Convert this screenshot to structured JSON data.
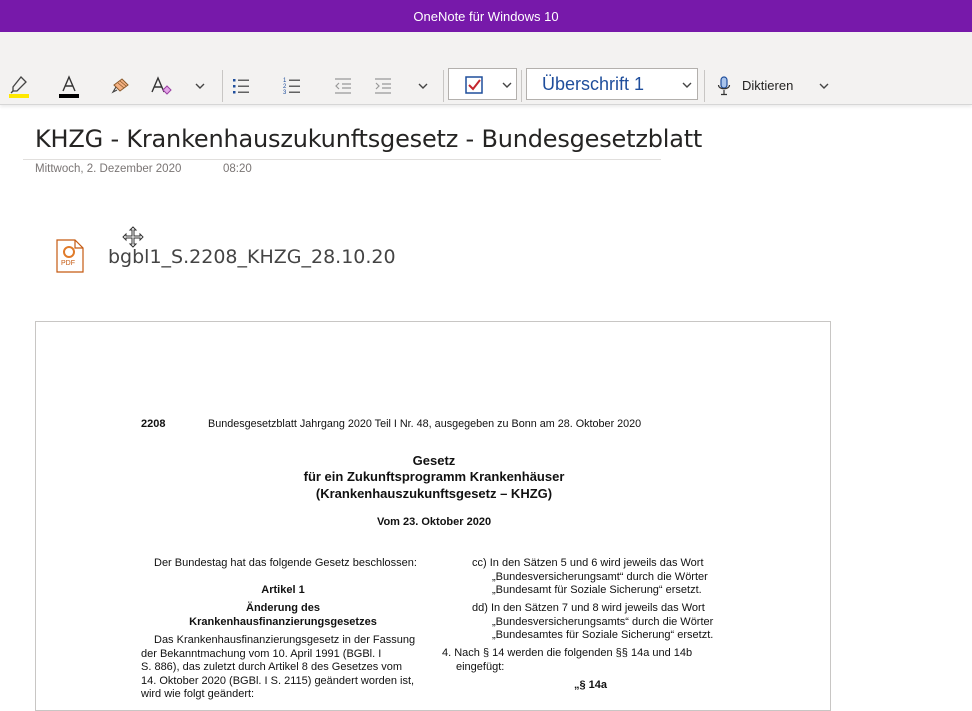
{
  "app": {
    "title": "OneNote für Windows 10"
  },
  "ribbon": {
    "highlight_color": "#ffe800",
    "font_color": "#000000",
    "style_value": "Überschrift 1",
    "dictate_label": "Diktieren",
    "icons": [
      "highlighter-icon",
      "font-color-icon",
      "format-painter-icon",
      "clear-formatting-icon",
      "bullets-icon",
      "numbering-icon",
      "outdent-icon",
      "indent-icon",
      "todo-checkbox-icon",
      "microphone-icon"
    ]
  },
  "page": {
    "title": "KHZG - Krankenhauszukunftsgesetz - Bundesgesetzblatt",
    "date": "Mittwoch, 2. Dezember 2020",
    "time": "08:20",
    "attachment": {
      "filename": "bgbl1_S.2208_KHZG_28.10.20",
      "icon": "pdf-file-icon",
      "icon_label": "PDF"
    }
  },
  "pdf": {
    "page_number": "2208",
    "header": "Bundesgesetzblatt Jahrgang 2020 Teil I Nr. 48, ausgegeben zu Bonn am 28. Oktober 2020",
    "title_line1": "Gesetz",
    "title_line2": "für ein Zukunftsprogramm Krankenhäuser",
    "title_line3": "(Krankenhauszukunftsgesetz – KHZG)",
    "date_line": "Vom 23. Oktober 2020",
    "left": {
      "intro": "Der Bundestag hat das folgende Gesetz beschlossen:",
      "article": "Artikel 1",
      "article_title1": "Änderung des",
      "article_title2": "Krankenhausfinanzierungsgesetzes",
      "lines": [
        "Das Krankenhausfinanzierungsgesetz in der Fassung",
        "der Bekanntmachung vom 10. April 1991 (BGBl. I",
        "S. 886), das zuletzt durch Artikel 8 des Gesetzes vom",
        "14. Oktober 2020 (BGBl. I S. 2115) geändert worden ist,",
        "wird wie folgt geändert:"
      ]
    },
    "right": {
      "cc1": "cc) In den Sätzen 5 und 6 wird jeweils das Wort",
      "cc2": "„Bundesversicherungsamt“ durch die Wörter",
      "cc3": "„Bundesamt für Soziale Sicherung“ ersetzt.",
      "dd1": "dd) In den Sätzen 7 und 8 wird jeweils das Wort",
      "dd2": "„Bundesversicherungsamts“ durch die Wörter",
      "dd3": "„Bundesamtes für Soziale Sicherung“ ersetzt.",
      "p4a": "4. Nach § 14 werden die folgenden §§ 14a und 14b",
      "p4b": "eingefügt:",
      "p14a": "„§ 14a"
    }
  }
}
